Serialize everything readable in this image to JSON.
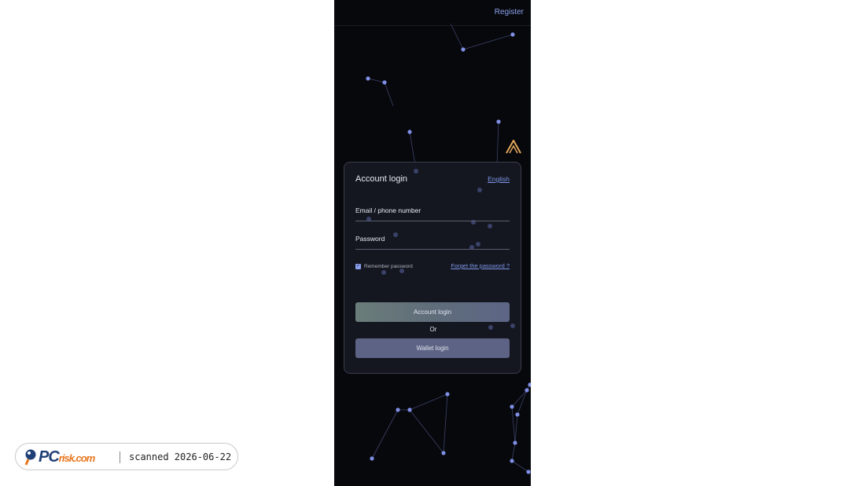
{
  "header": {
    "register_label": "Register"
  },
  "login_card": {
    "title": "Account login",
    "language": "English",
    "email_label": "Email / phone number",
    "password_label": "Password",
    "remember_label": "Remember password",
    "remember_checked": true,
    "forgot_label": "Forget the password ?",
    "account_login_button": "Account login",
    "or_label": "Or",
    "wallet_login_button": "Wallet login"
  },
  "icons": {
    "logo": "logo-icon",
    "checkbox": "check-icon",
    "network": "particle-network-background"
  },
  "colors": {
    "background": "#07080c",
    "accent": "#8da2f0",
    "logo": "#e2a85a"
  },
  "watermark": {
    "brand": "PC",
    "brand_suffix": "risk.com",
    "text": "scanned 2026-06-22"
  }
}
